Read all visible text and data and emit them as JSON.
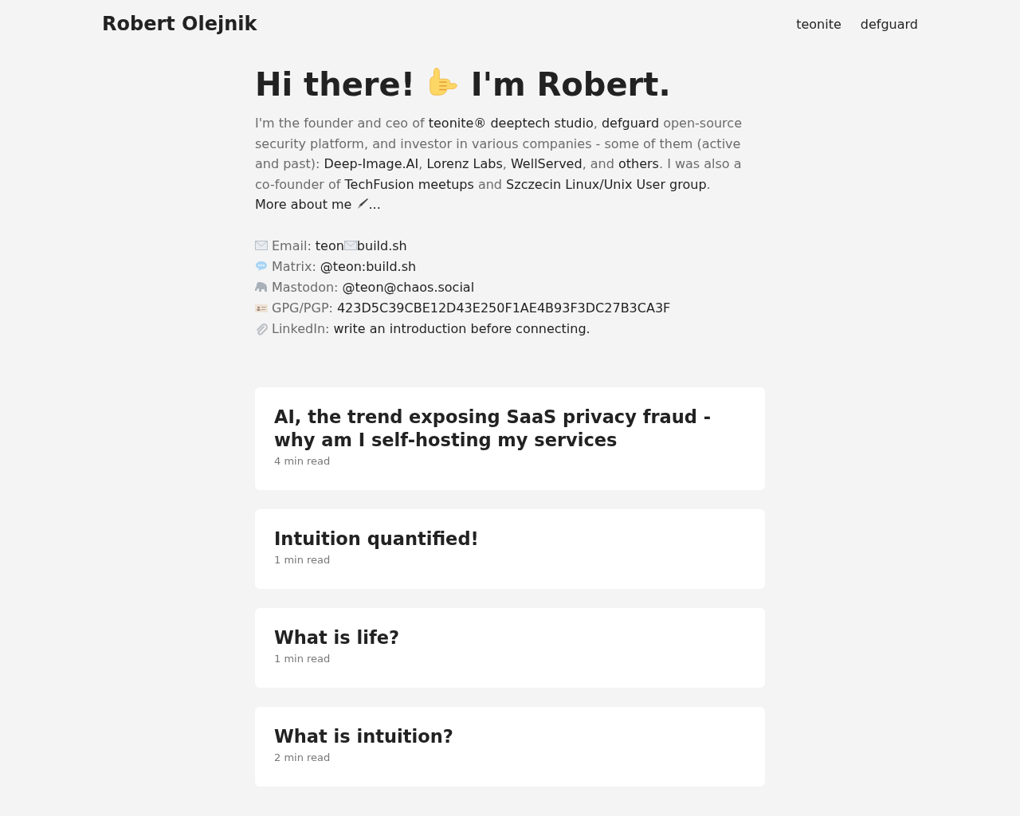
{
  "header": {
    "site_title": "Robert Olejnik",
    "nav": [
      {
        "label": "teonite"
      },
      {
        "label": "defguard"
      }
    ]
  },
  "intro": {
    "heading_before": "Hi there!",
    "heading_after": "I'm Robert.",
    "paragraph": [
      {
        "text": "I'm the founder and ceo of ",
        "kind": "text"
      },
      {
        "text": "teonite® deeptech studio",
        "kind": "link"
      },
      {
        "text": ", ",
        "kind": "text"
      },
      {
        "text": "defguard",
        "kind": "link"
      },
      {
        "text": " open-source security platform, and investor in various companies - some of them (active and past): ",
        "kind": "text"
      },
      {
        "text": "Deep-Image.AI",
        "kind": "link"
      },
      {
        "text": ", ",
        "kind": "text"
      },
      {
        "text": "Lorenz Labs",
        "kind": "link"
      },
      {
        "text": ", ",
        "kind": "text"
      },
      {
        "text": "WellServed",
        "kind": "link"
      },
      {
        "text": ", and ",
        "kind": "text"
      },
      {
        "text": "others",
        "kind": "link"
      },
      {
        "text": ". I was also a co-founder of ",
        "kind": "text"
      },
      {
        "text": "TechFusion meetups",
        "kind": "link"
      },
      {
        "text": " and ",
        "kind": "text"
      },
      {
        "text": "Szczecin Linux/Unix User group",
        "kind": "link"
      },
      {
        "text": ".",
        "kind": "text"
      }
    ],
    "more_link": {
      "text_before": "More about me",
      "text_after": "..."
    }
  },
  "contacts": [
    {
      "kind": "email",
      "label": "Email:",
      "value_parts": [
        "teon",
        "build.sh"
      ]
    },
    {
      "kind": "matrix",
      "label": "Matrix:",
      "value_parts": [
        "@teon:build.sh"
      ]
    },
    {
      "kind": "mastodon",
      "label": "Mastodon:",
      "value_parts": [
        "@teon@chaos.social"
      ]
    },
    {
      "kind": "gpg",
      "label": "GPG/PGP:",
      "value_parts": [
        "423D5C39CBE12D43E250F1AE4B93F3DC27B3CA3F"
      ]
    },
    {
      "kind": "linkedin",
      "label": "LinkedIn:",
      "value_parts": [
        "write an introduction before connecting."
      ]
    }
  ],
  "posts": [
    {
      "title": "AI, the trend exposing SaaS privacy fraud - why am I self-hosting my services",
      "meta": "4 min read"
    },
    {
      "title": "Intuition quantified!",
      "meta": "1 min read"
    },
    {
      "title": "What is life?",
      "meta": "1 min read"
    },
    {
      "title": "What is intuition?",
      "meta": "2 min read"
    }
  ]
}
